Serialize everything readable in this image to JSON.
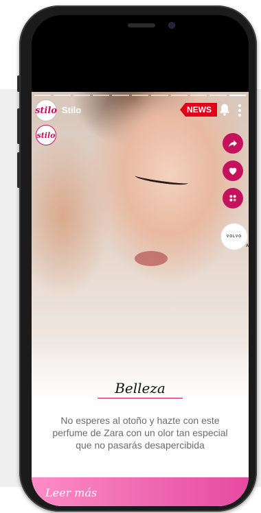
{
  "story": {
    "progress_segments": 11,
    "active_segment": 10,
    "brand": {
      "avatar_text": "stilo",
      "name": "Stilo"
    },
    "news_badge": "NEWS",
    "logo_small_text": "stilo",
    "ad": {
      "brand_text": "VOLVO",
      "label": "AD"
    },
    "category": "Belleza",
    "headline": "No esperes al otoño y hazte con este perfume de Zara con un olor tan especial que no pasarás desapercibida",
    "cta": "Leer más"
  },
  "colors": {
    "accent": "#c4125c",
    "news_red": "#e0001b",
    "cta_pink": "#f06bb3",
    "text_grey": "#6b6b6b"
  },
  "icons": [
    "bell-icon",
    "more-vertical-icon",
    "share-icon",
    "heart-icon",
    "emoji-icon"
  ]
}
